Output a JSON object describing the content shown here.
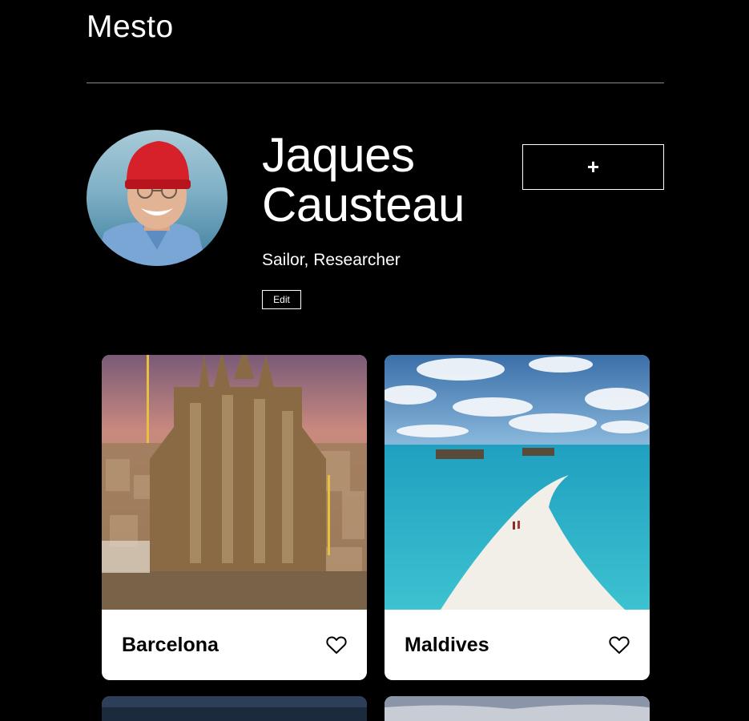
{
  "header": {
    "logo": "Mesto"
  },
  "profile": {
    "name": "Jaques Causteau",
    "about": "Sailor, Researcher",
    "edit_label": "Edit",
    "add_label": "+"
  },
  "cards": [
    {
      "title": "Barcelona"
    },
    {
      "title": "Maldives"
    }
  ],
  "colors": {
    "background": "#000000",
    "text": "#ffffff",
    "card_background": "#ffffff",
    "card_text": "#000000",
    "divider": "#8a8a8a"
  }
}
